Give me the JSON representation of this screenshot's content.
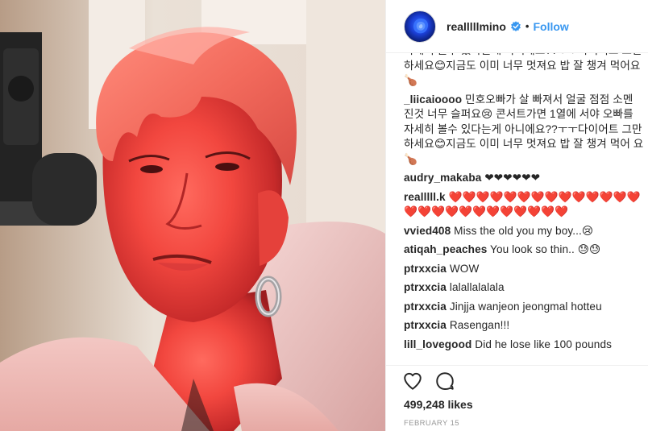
{
  "photo": {
    "alt_icon": "selfie-photo"
  },
  "header": {
    "username": "realllllmino",
    "separator": "•",
    "follow_label": "Follow",
    "verified_icon": "verified-badge-icon",
    "accent": "#3897f0"
  },
  "comments": [
    {
      "user": "",
      "text": "자세히 볼수 있다는게 아니에요??ㅜㅜ다이어트 그만 하세요😊지금도 이미 너무 멋져요 밥 잘 챙겨 먹어요🍗"
    },
    {
      "user": "_liicaioooo",
      "text": "민호오빠가 살 빠져서 얼굴 점점 소멘 진것 너무 슬퍼요😢 콘서트가면 1열에 서야 오빠를 자세히 볼수 있다는게 아니에요??ㅜㅜ다이어트 그만 하세요😊지금도 이미 너무 멋져요 밥 잘 챙겨 먹어 요🍗"
    },
    {
      "user": "audry_makaba",
      "text": "❤❤❤❤❤❤"
    },
    {
      "user": "realllll.k",
      "text": "❤️❤️❤️❤️❤️❤️❤️❤️❤️❤️❤️❤️❤️❤️❤️❤️❤️❤️❤️❤️❤️❤️❤️❤️❤️❤️"
    },
    {
      "user": "vvied408",
      "text": "Miss the old you my boy...😢"
    },
    {
      "user": "atiqah_peaches",
      "text": "You look so thin.. 😓😓"
    },
    {
      "user": "ptrxxcia",
      "text": "WOW"
    },
    {
      "user": "ptrxxcia",
      "text": "lalallalalala"
    },
    {
      "user": "ptrxxcia",
      "text": "Jinjja wanjeon jeongmal hotteu"
    },
    {
      "user": "ptrxxcia",
      "text": "Rasengan!!!"
    },
    {
      "user": "lill_lovegood",
      "text": "Did he lose like 100 pounds"
    }
  ],
  "actions": {
    "like_icon": "heart-icon",
    "comment_icon": "comment-icon"
  },
  "likes": "499,248 likes",
  "date": "FEBRUARY 15"
}
